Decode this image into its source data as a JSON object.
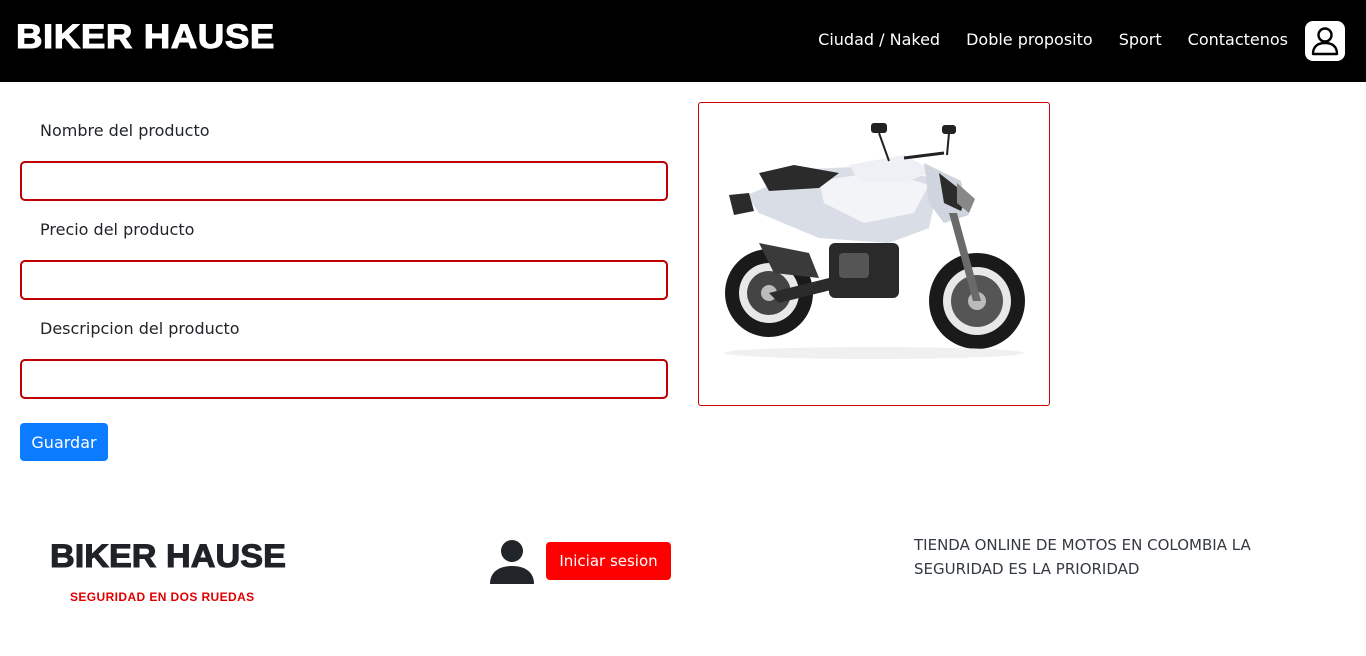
{
  "navbar": {
    "brand": "BIKER HAUSE",
    "links": [
      "Ciudad / Naked",
      "Doble proposito",
      "Sport",
      "Contactenos"
    ],
    "user_icon": "user-icon"
  },
  "form": {
    "name_label": "Nombre del producto",
    "name_value": "",
    "price_label": "Precio del producto",
    "price_value": "",
    "description_label": "Descripcion del producto",
    "description_value": "",
    "save_label": "Guardar"
  },
  "product_image": {
    "alt": "motorcycle-image"
  },
  "footer": {
    "brand": "BIKER HAUSE",
    "tagline": "SEGURIDAD EN DOS RUEDAS",
    "login_label": "Iniciar sesion",
    "user_icon": "user-icon",
    "description": "TIENDA ONLINE DE MOTOS EN COLOMBIA LA SEGURIDAD ES LA PRIORIDAD"
  },
  "colors": {
    "navbar_bg": "#000000",
    "input_border": "#c00000",
    "save_button": "#0b7bff",
    "login_button": "#ff0000",
    "tagline": "#e00000"
  }
}
